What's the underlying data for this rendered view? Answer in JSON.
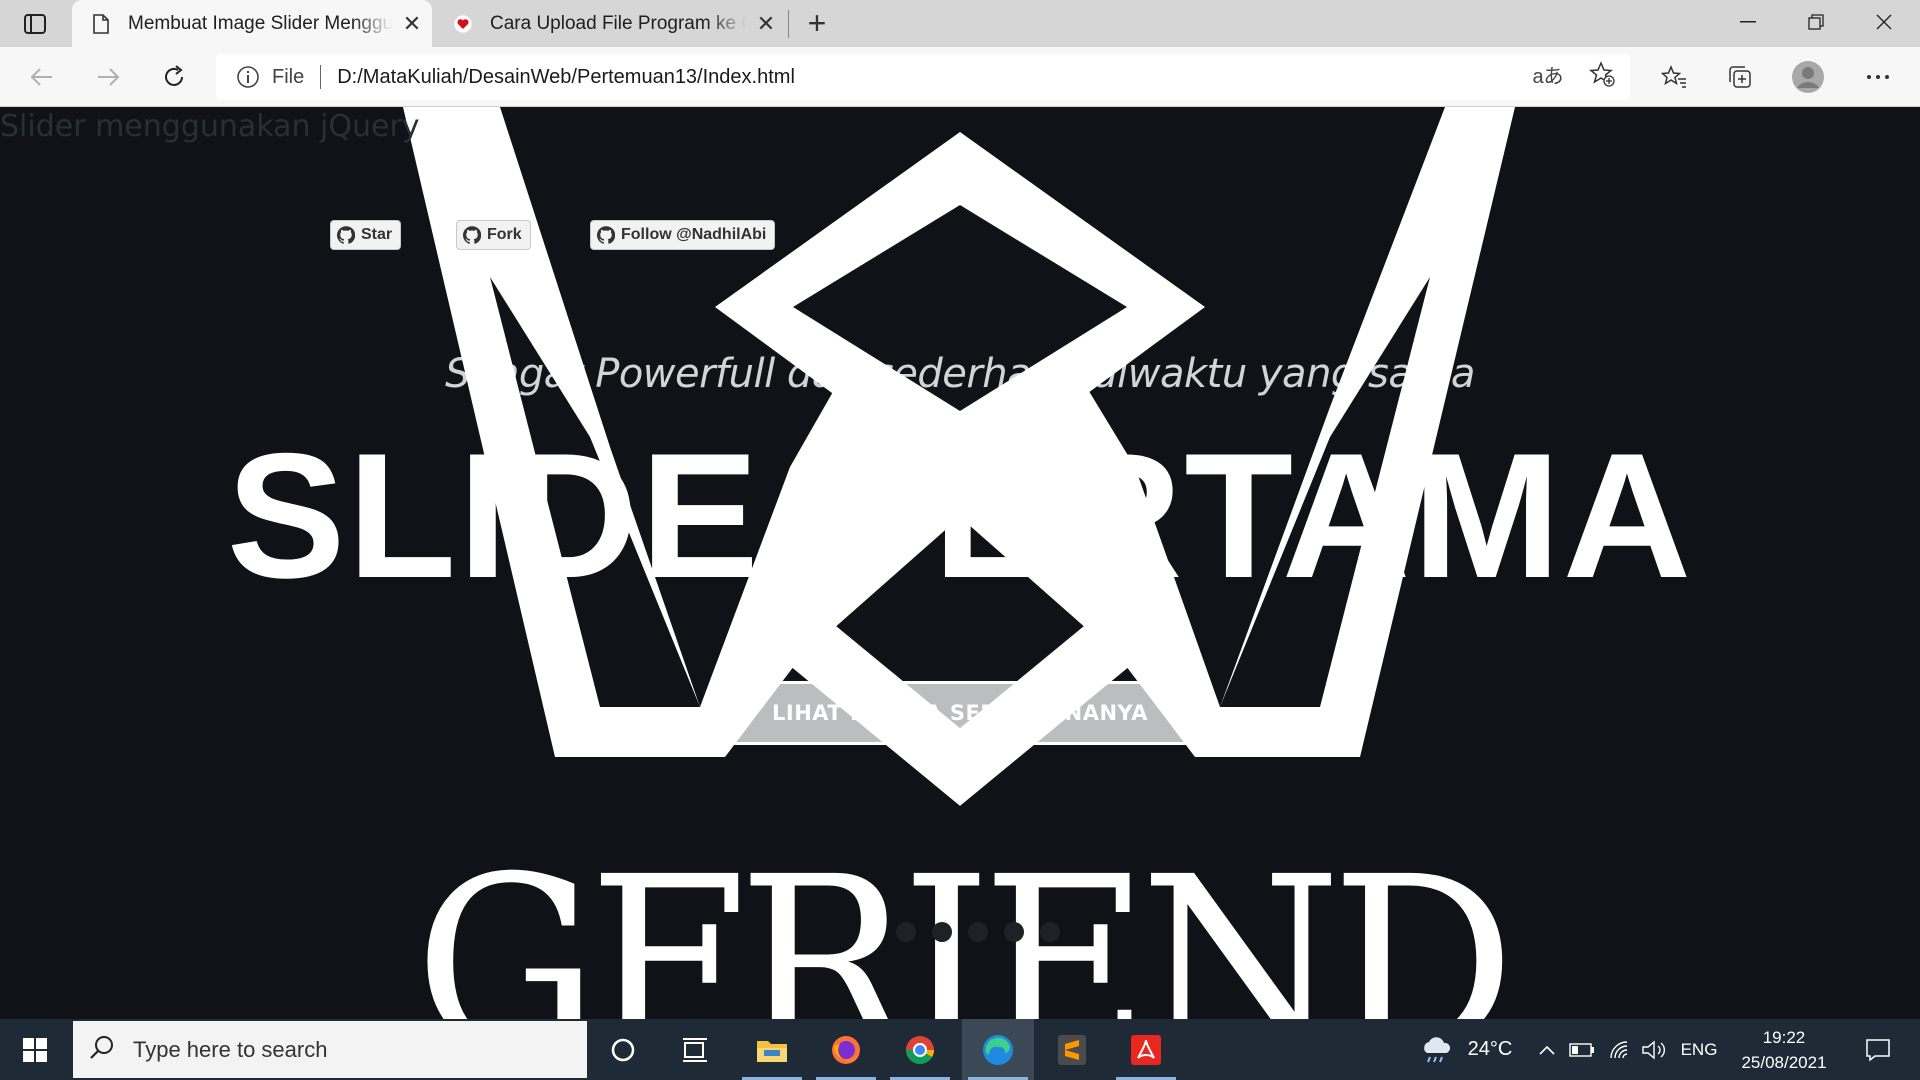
{
  "browser": {
    "tabs": [
      {
        "title": "Membuat Image Slider Menggunakan jQuery",
        "icon": "page-icon",
        "active": true
      },
      {
        "title": "Cara Upload File Program ke GitHub",
        "icon": "heart-icon",
        "active": false
      }
    ],
    "address": {
      "scheme": "File",
      "url": "D:/MataKuliah/DesainWeb/Pertemuan13/Index.html"
    }
  },
  "page": {
    "title": "Slider menggunakan jQuery",
    "github_buttons": {
      "star": "Star",
      "fork": "Fork",
      "follow": "Follow @NadhilAbi"
    },
    "slide": {
      "tagline": "Sangat Powerfull dan sederhana diwaktu yang sama",
      "headline": "SLIDE PERTAMA",
      "cta": "LIHAT BETAPA SEDERHANANYA",
      "background_word": "GFRIEND"
    },
    "slider": {
      "slide_count": 6,
      "current_index": 0
    }
  },
  "taskbar": {
    "search_placeholder": "Type here to search",
    "weather": "24°C",
    "language": "ENG",
    "time": "19:22",
    "date": "25/08/2021",
    "apps": [
      "cortana-icon",
      "task-view-icon",
      "file-explorer-icon",
      "firefox-icon",
      "chrome-icon",
      "edge-icon",
      "sublime-text-icon",
      "acrobat-icon"
    ]
  },
  "colors": {
    "page_bg": "#101218",
    "taskbar_bg": "#1e2a36",
    "tab_strip_bg": "#d6d6d6"
  }
}
